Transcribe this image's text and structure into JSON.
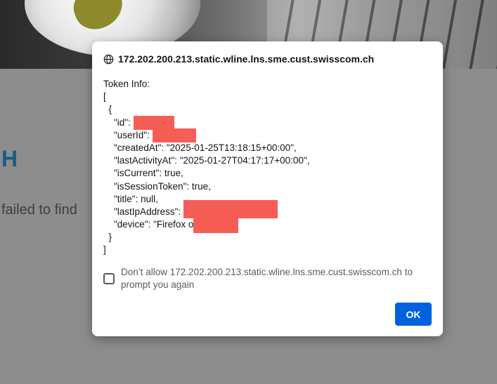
{
  "background": {
    "heading": "H",
    "text": "failed to find"
  },
  "dialog": {
    "title": "172.202.200.213.static.wline.lns.sme.cust.swisscom.ch",
    "title_icon": "globe-icon",
    "message": {
      "line_0": "Token Info:",
      "line_1": "[",
      "line_2": "  {",
      "line_3": "    \"id\": ",
      "line_4": "    \"userId\": ",
      "line_5": "    \"createdAt\": \"2025-01-25T13:18:15+00:00\",",
      "line_6": "    \"lastActivityAt\": \"2025-01-27T04:17:17+00:00\",",
      "line_7": "    \"isCurrent\": true,",
      "line_8": "    \"isSessionToken\": true,",
      "line_9": "    \"title\": null,",
      "line_10": "    \"lastIpAddress\": ",
      "line_11": "    \"device\": \"Firefox on ",
      "line_12": "  }",
      "line_13": "]"
    },
    "checkbox": {
      "checked": false,
      "label": "Don’t allow 172.202.200.213.static.wline.lns.sme.cust.swisscom.ch to prompt you again"
    },
    "ok_label": "OK",
    "colors": {
      "ok_button": "#0061e0",
      "redaction": "#f65e55"
    }
  }
}
